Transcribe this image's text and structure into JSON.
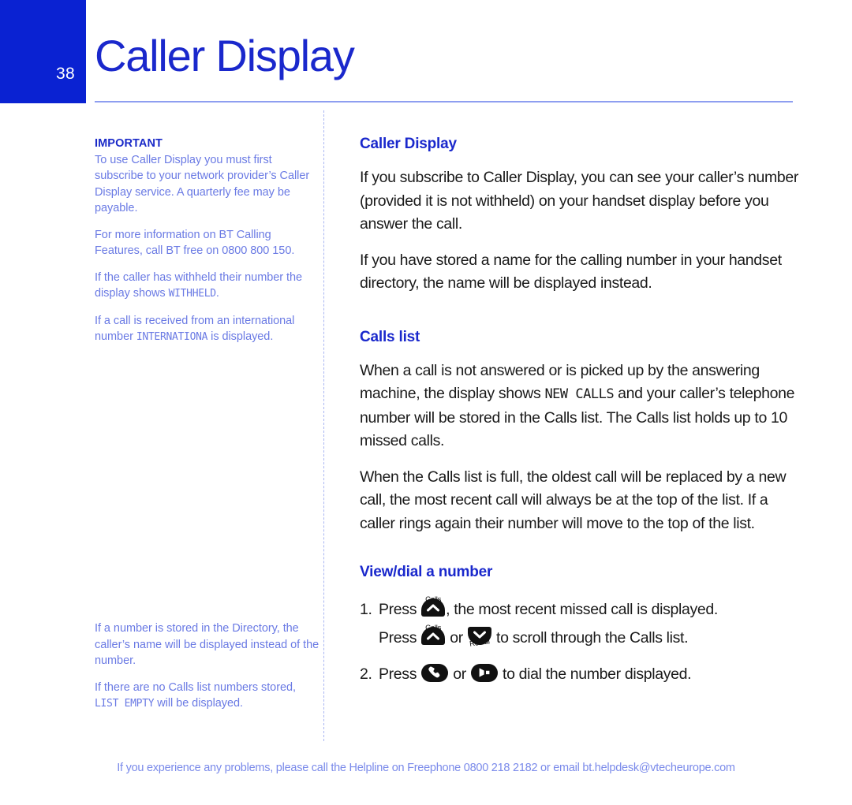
{
  "header": {
    "page_number": "38",
    "title": "Caller Display",
    "accent_blue": "#0a22d2",
    "title_blue": "#1a28cc",
    "rule_blue": "#8e9ef0"
  },
  "sidebar": {
    "notes_top": {
      "heading": "IMPORTANT",
      "paragraphs": [
        "To use Caller Display you must  first subscribe to your network provider’s Caller Display service. A quarterly fee may be payable.",
        "For more information on BT Calling Features, call BT free on 0800 800 150."
      ],
      "note_withheld_pre": "If the caller has withheld their number the display shows ",
      "note_withheld_lcd": "WITHHELD",
      "note_withheld_post": ".",
      "note_intl_pre": "If a call is received from  an international number ",
      "note_intl_lcd": "INTERNATIONA",
      "note_intl_post": " is displayed."
    },
    "notes_bottom": {
      "note_directory": "If a number is stored in the Directory, the caller’s name will be displayed instead of the number.",
      "note_empty_pre": "If there are no Calls list numbers stored, ",
      "note_empty_lcd": "LIST EMPTY",
      "note_empty_post": " will be displayed."
    },
    "body_blue": "#6a7ae4",
    "heading_blue": "#1a2ac8"
  },
  "main": {
    "caller_display": {
      "heading": "Caller Display",
      "para1": "If you subscribe to Caller Display, you can see your caller’s number (provided it is not withheld) on your handset display before you answer the call.",
      "para2": "If you have stored a name for the calling number in your handset directory, the name will be displayed instead."
    },
    "calls_list": {
      "heading": "Calls list",
      "para1_pre": "When a call is not answered or is picked up by the answering machine, the display shows ",
      "para1_lcd": "NEW CALLS",
      "para1_post": " and your caller’s telephone number will be stored in the Calls list. The Calls list holds up to 10 missed calls.",
      "para2": "When the Calls list is full, the oldest call will be replaced by a new call, the most recent call will always be at the top of the list. If a caller rings again their number will move to the top of the list."
    },
    "view_dial": {
      "heading": "View/dial a number",
      "step1_num": "1.",
      "step1_pre": "Press ",
      "step1_post": ", the most recent missed call is displayed.",
      "step1b_pre": "Press ",
      "step1b_mid": " or ",
      "step1b_post": " to scroll through the Calls list.",
      "step2_num": "2.",
      "step2_pre": "Press ",
      "step2_mid": " or ",
      "step2_post": " to dial the number displayed.",
      "key_calls_label": "Calls",
      "key_redial_label": "Redial"
    }
  },
  "footer": {
    "text": "If you experience any problems, please call the Helpline on Freephone 0800 218 2182 or email bt.helpdesk@vtecheurope.com",
    "color": "#7a8aea"
  }
}
